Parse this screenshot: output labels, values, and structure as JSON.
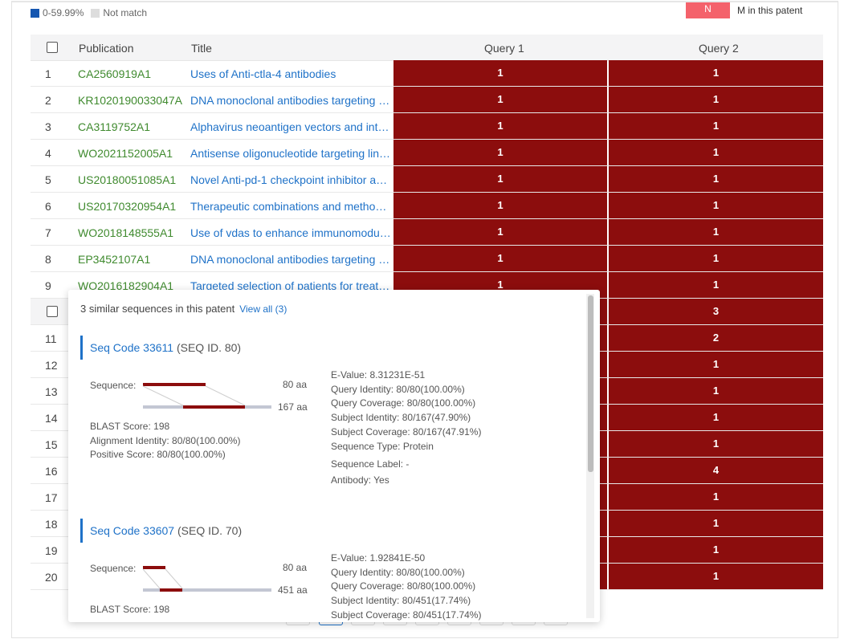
{
  "legend": {
    "range_label": "0-59.99%",
    "range_color": "#1556b0",
    "notmatch_label": "Not match",
    "notmatch_color": "#dddddd",
    "n_label": "N",
    "n_color": "#f4626b",
    "m_label": "M in this patent"
  },
  "table": {
    "headers": {
      "publication": "Publication",
      "title": "Title",
      "query1": "Query 1",
      "query2": "Query 2"
    },
    "match_color": "#8c0d0d",
    "rows": [
      {
        "num": "1",
        "pub": "CA2560919A1",
        "title": "Uses of Anti-ctla-4 antibodies",
        "q1": "1",
        "q2": "1"
      },
      {
        "num": "2",
        "pub": "KR1020190033047A",
        "title": "DNA monoclonal antibodies targeting …",
        "q1": "1",
        "q2": "1"
      },
      {
        "num": "3",
        "pub": "CA3119752A1",
        "title": "Alphavirus neoantigen vectors and int…",
        "q1": "1",
        "q2": "1"
      },
      {
        "num": "4",
        "pub": "WO2021152005A1",
        "title": "Antisense oligonucleotide targeting lin…",
        "q1": "1",
        "q2": "1"
      },
      {
        "num": "5",
        "pub": "US20180051085A1",
        "title": "Novel Anti-pd-1 checkpoint inhibitor a…",
        "q1": "1",
        "q2": "1"
      },
      {
        "num": "6",
        "pub": "US20170320954A1",
        "title": "Therapeutic combinations and metho…",
        "q1": "1",
        "q2": "1"
      },
      {
        "num": "7",
        "pub": "WO2018148555A1",
        "title": "Use of vdas to enhance immunomodu…",
        "q1": "1",
        "q2": "1"
      },
      {
        "num": "8",
        "pub": "EP3452107A1",
        "title": "DNA monoclonal antibodies targeting …",
        "q1": "1",
        "q2": "1"
      },
      {
        "num": "9",
        "pub": "WO2016182904A1",
        "title": "Targeted selection of patients for treat…",
        "q1": "1",
        "q2": "1"
      },
      {
        "num": "",
        "pub": "",
        "title": "",
        "q1": "",
        "q2": "3"
      },
      {
        "num": "11",
        "pub": "",
        "title": "",
        "q1": "",
        "q2": "2"
      },
      {
        "num": "12",
        "pub": "",
        "title": "",
        "q1": "",
        "q2": "1"
      },
      {
        "num": "13",
        "pub": "",
        "title": "",
        "q1": "",
        "q2": "1"
      },
      {
        "num": "14",
        "pub": "",
        "title": "",
        "q1": "",
        "q2": "1"
      },
      {
        "num": "15",
        "pub": "",
        "title": "",
        "q1": "",
        "q2": "1"
      },
      {
        "num": "16",
        "pub": "",
        "title": "",
        "q1": "",
        "q2": "4"
      },
      {
        "num": "17",
        "pub": "",
        "title": "",
        "q1": "",
        "q2": "1"
      },
      {
        "num": "18",
        "pub": "",
        "title": "",
        "q1": "",
        "q2": "1"
      },
      {
        "num": "19",
        "pub": "",
        "title": "",
        "q1": "",
        "q2": "1"
      },
      {
        "num": "20",
        "pub": "",
        "title": "",
        "q1": "",
        "q2": "1"
      }
    ]
  },
  "popup": {
    "heading": "3 similar sequences in this patent",
    "view_all": "View all (3)",
    "seq1": {
      "code": "Seq Code 33611",
      "id": "(SEQ ID. 80)",
      "sequence_label": "Sequence:",
      "query_len": "80 aa",
      "subject_len": "167 aa",
      "blast": "BLAST Score: 198",
      "align": "Alignment Identity: 80/80(100.00%)",
      "positive": "Positive Score: 80/80(100.00%)",
      "evalue": "E-Value: 8.31231E-51",
      "qid": "Query Identity: 80/80(100.00%)",
      "qcov": "Query Coverage: 80/80(100.00%)",
      "sid": "Subject Identity: 80/167(47.90%)",
      "scov": "Subject Coverage: 80/167(47.91%)",
      "stype": "Sequence Type: Protein",
      "slabel": "Sequence Label: -",
      "antibody": "Antibody: Yes"
    },
    "seq2": {
      "code": "Seq Code 33607",
      "id": "(SEQ ID. 70)",
      "sequence_label": "Sequence:",
      "query_len": "80 aa",
      "subject_len": "451 aa",
      "blast": "BLAST Score: 198",
      "evalue": "E-Value: 1.92841E-50",
      "qid": "Query Identity: 80/80(100.00%)",
      "qcov": "Query Coverage: 80/80(100.00%)",
      "sid": "Subject Identity: 80/451(17.74%)",
      "scov": "Subject Coverage: 80/451(17.74%)"
    }
  }
}
